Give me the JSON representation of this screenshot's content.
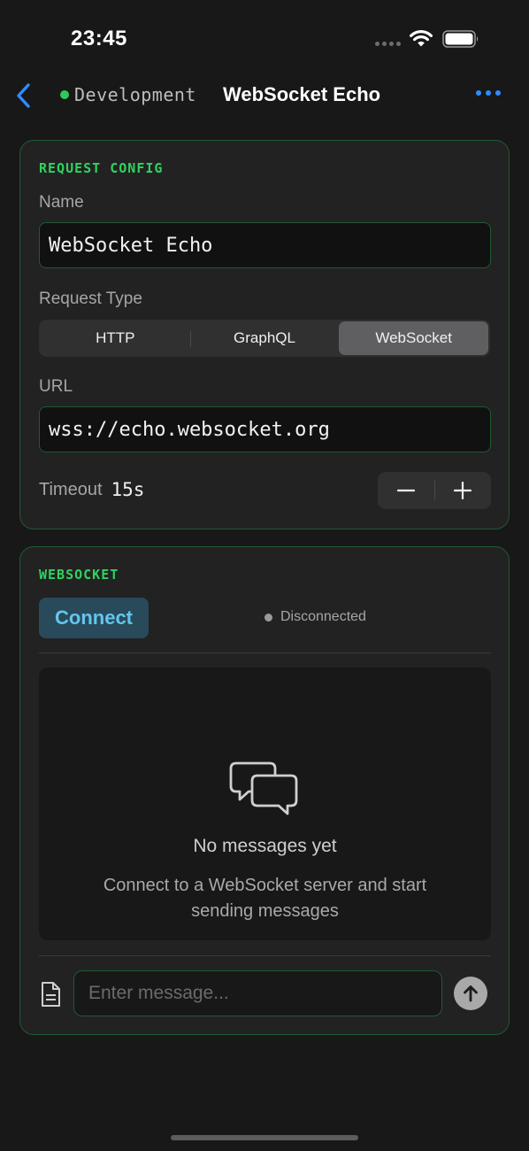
{
  "status_bar": {
    "time": "23:45",
    "icons": [
      "signal-dots-icon",
      "wifi-icon",
      "battery-icon"
    ]
  },
  "nav": {
    "back_icon": "chevron-left-icon",
    "environment": "Development",
    "environment_color": "#30c856",
    "title": "WebSocket Echo",
    "more_icon": "ellipsis-icon"
  },
  "request_config": {
    "section_label": "REQUEST CONFIG",
    "name_label": "Name",
    "name_value": "WebSocket Echo",
    "type_label": "Request Type",
    "types": [
      "HTTP",
      "GraphQL",
      "WebSocket"
    ],
    "selected_type": "WebSocket",
    "url_label": "URL",
    "url_value": "wss://echo.websocket.org",
    "timeout_label": "Timeout",
    "timeout_value": "15s",
    "stepper_icons": [
      "minus-icon",
      "plus-icon"
    ]
  },
  "websocket": {
    "section_label": "WEBSOCKET",
    "connect_label": "Connect",
    "status": "Disconnected",
    "empty_title": "No messages yet",
    "empty_subtitle": "Connect to a WebSocket server and start sending messages",
    "message_placeholder": "Enter message...",
    "message_value": "",
    "icons": [
      "chat-bubbles-icon",
      "document-icon",
      "send-arrow-icon"
    ]
  },
  "colors": {
    "accent_green": "#2fd35f",
    "card_border": "#1f5a33",
    "link_blue": "#2f8cff",
    "connect_text": "#63c6ec",
    "connect_bg": "#294a5a"
  }
}
